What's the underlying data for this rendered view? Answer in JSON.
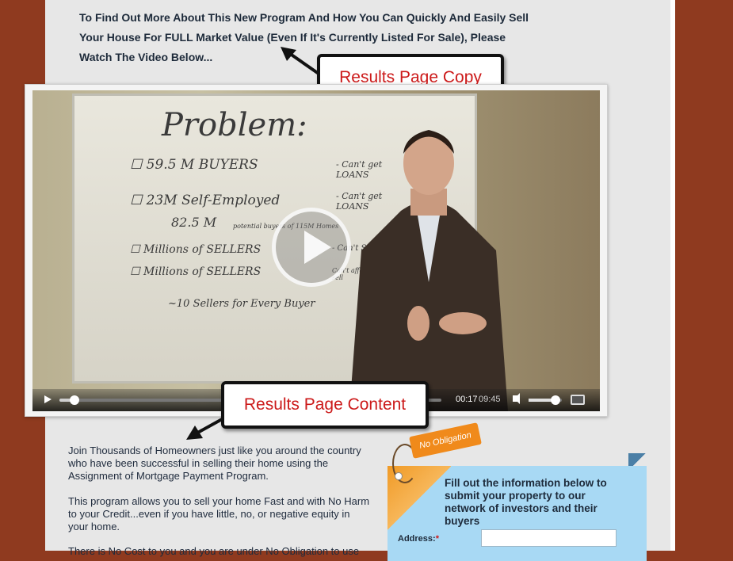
{
  "headline": {
    "line1": "To Find Out More About This New Program And How You Can Quickly And Easily Sell",
    "line2": "Your House For FULL Market Value (Even If It's Currently Listed For Sale), Please",
    "line3": "Watch The Video Below..."
  },
  "callouts": {
    "copy": "Results Page Copy",
    "content": "Results Page Content"
  },
  "video": {
    "whiteboard": {
      "title": "Problem:",
      "line1": "59.5 M BUYERS",
      "line1_note": "- Can't get LOANS",
      "line2": "23M Self-Employed",
      "line2_note": "- Can't get LOANS",
      "line3": "82.5 M",
      "line3_note": "potential buyers of 115M Homes",
      "line4": "Millions of SELLERS",
      "line4_note": "- Can't Sell",
      "line5": "Millions of SELLERS",
      "line5_note": "Can't afford to sell",
      "line6": "~10 Sellers for Every Buyer"
    },
    "time_current": "00:17",
    "time_total": "09:45",
    "progress": 0.04,
    "volume": 0.8
  },
  "body": {
    "para1_line1": "Join Thousands of Homeowners just like you around the country",
    "para1_line2": "who have been successful in selling their home using the",
    "para1_line3": "Assignment of Mortgage Payment Program.",
    "para2_line1": "This program allows you to sell your home Fast and with No Harm",
    "para2_line2": "to your Credit...even if you have little, no, or negative equity in",
    "para2_line3": "your home.",
    "para3_line1": "There is No Cost to you and you are under No Obligation to use"
  },
  "form": {
    "tag": "No Obligation",
    "heading_line1": "Fill out the information below to",
    "heading_line2": "submit your property to our",
    "heading_line3": "network of investors and their",
    "heading_line4": "buyers",
    "address_label": "Address:",
    "required_mark": "*",
    "address_value": ""
  }
}
